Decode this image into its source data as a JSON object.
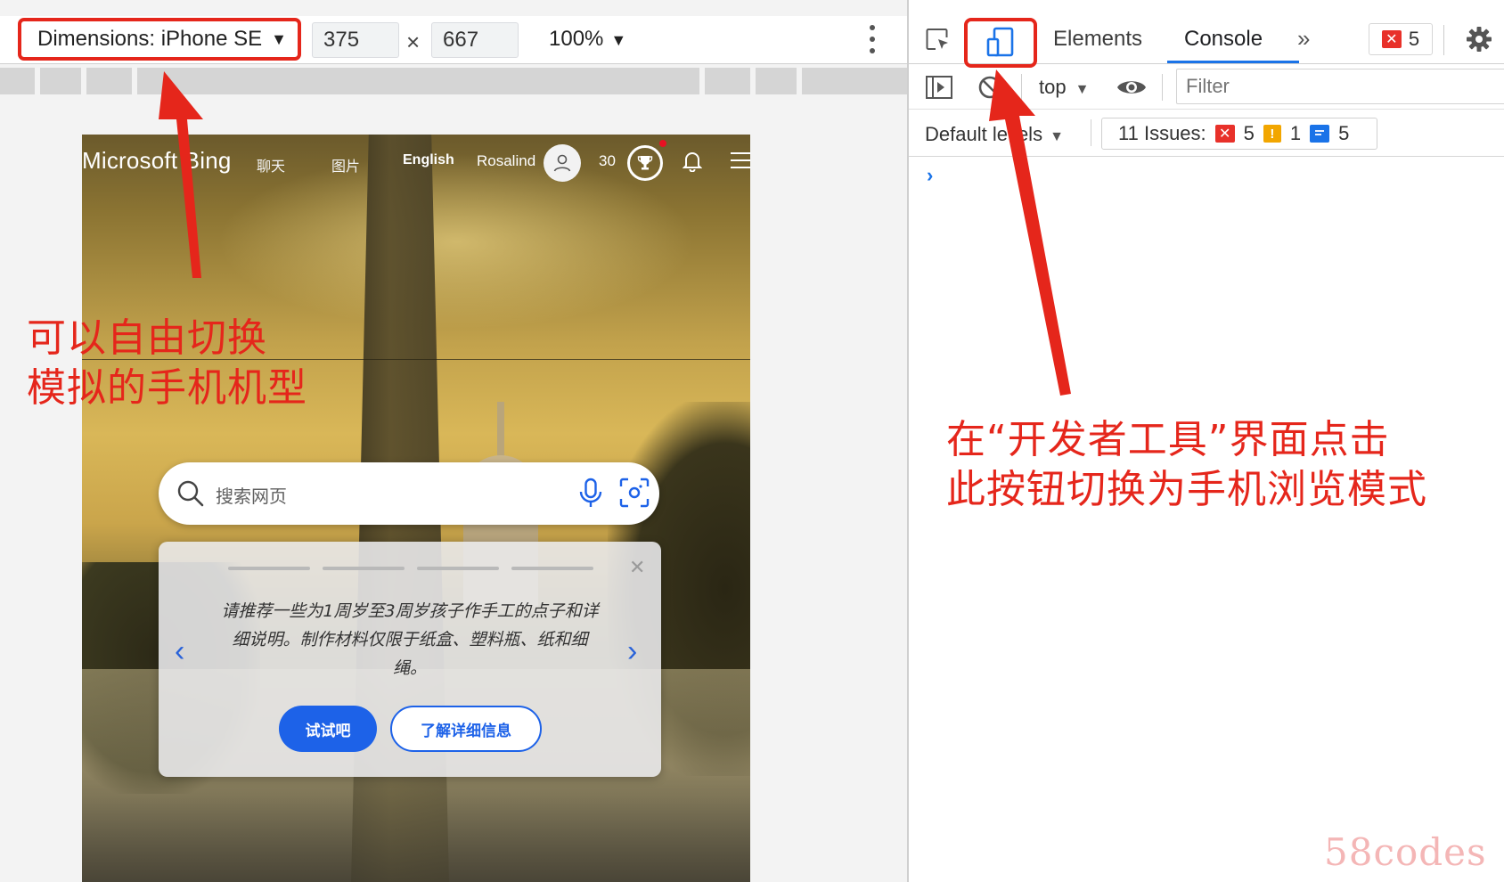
{
  "emulation_toolbar": {
    "device_label": "Dimensions: iPhone SE",
    "width_value": "375",
    "height_value": "667",
    "times_symbol": "×",
    "zoom_label": "100%",
    "caret": "▼"
  },
  "phone_page": {
    "logo": "Microsoft Bing",
    "nav": [
      "聊天",
      "图片"
    ],
    "language": "English",
    "user_name": "Rosalind",
    "points": "30",
    "search_placeholder": "搜索网页",
    "prompt_card": {
      "text": "请推荐一些为1周岁至3周岁孩子作手工的点子和详细说明。制作材料仅限于纸盒、塑料瓶、纸和细绳。",
      "prev_glyph": "‹",
      "next_glyph": "›",
      "close_glyph": "✕",
      "try_button": "试试吧",
      "learn_more_button": "了解详细信息"
    }
  },
  "devtools": {
    "tabs": {
      "elements": "Elements",
      "console": "Console",
      "more": "»"
    },
    "error_count": "5",
    "console_bar": {
      "context": "top",
      "filter_placeholder": "Filter"
    },
    "levels_label": "Default levels",
    "issues": {
      "label": "11 Issues:",
      "errors": "5",
      "warnings": "1",
      "info": "5"
    },
    "prompt_glyph": "›"
  },
  "annotations": {
    "left_line1": "可以自由切换",
    "left_line2": "模拟的手机机型",
    "right_line1": "在“开发者工具”界面点击",
    "right_line2": "此按钮切换为手机浏览模式"
  },
  "watermark": "58codes",
  "colors": {
    "annotation_red": "#e5261b",
    "devtools_blue": "#1a73e8",
    "bing_button_blue": "#1d62e8",
    "error_red": "#e8312a",
    "warning_amber": "#f2a600"
  },
  "icons": [
    "inspect-element-icon",
    "device-toolbar-icon",
    "sidebar-icon",
    "clear-console-icon",
    "eye-icon",
    "gear-icon",
    "search-icon",
    "mic-icon",
    "visual-search-icon",
    "bell-icon",
    "trophy-icon",
    "avatar-icon",
    "hamburger-icon"
  ]
}
